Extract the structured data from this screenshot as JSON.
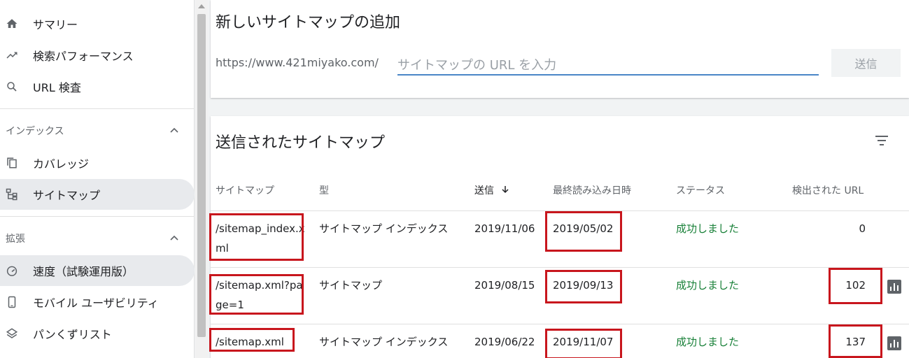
{
  "sidebar": {
    "items": [
      {
        "label": "サマリー",
        "icon": "home-icon"
      },
      {
        "label": "検索パフォーマンス",
        "icon": "trending-icon"
      },
      {
        "label": "URL 検査",
        "icon": "search-icon"
      }
    ],
    "index_section": {
      "title": "インデックス",
      "items": [
        {
          "label": "カバレッジ",
          "icon": "copy-icon"
        },
        {
          "label": "サイトマップ",
          "icon": "sitemap-icon",
          "selected": true
        }
      ]
    },
    "enhance_section": {
      "title": "拡張",
      "items": [
        {
          "label": "速度（試験運用版）",
          "icon": "speed-icon",
          "selected": true
        },
        {
          "label": "モバイル ユーザビリティ",
          "icon": "phone-icon"
        },
        {
          "label": "パンくずリスト",
          "icon": "layers-icon"
        }
      ]
    }
  },
  "add_sitemap": {
    "title": "新しいサイトマップの追加",
    "prefix": "https://www.421miyako.com/",
    "placeholder": "サイトマップの URL を入力",
    "submit_label": "送信"
  },
  "submitted": {
    "title": "送信されたサイトマップ",
    "columns": {
      "sitemap": "サイトマップ",
      "type": "型",
      "submitted": "送信",
      "last_read": "最終読み込み日時",
      "status": "ステータス",
      "urls": "検出された URL"
    },
    "rows": [
      {
        "sitemap": "/sitemap_index.xml",
        "type": "サイトマップ インデックス",
        "submitted": "2019/11/06",
        "last_read": "2019/05/02",
        "status": "成功しました",
        "urls": "0"
      },
      {
        "sitemap": "/sitemap.xml?page=1",
        "type": "サイトマップ",
        "submitted": "2019/08/15",
        "last_read": "2019/09/13",
        "status": "成功しました",
        "urls": "102"
      },
      {
        "sitemap": "/sitemap.xml",
        "type": "サイトマップ インデックス",
        "submitted": "2019/06/22",
        "last_read": "2019/11/07",
        "status": "成功しました",
        "urls": "137"
      }
    ]
  },
  "colors": {
    "highlight": "#c8161d",
    "success": "#188038",
    "input_underline": "#4a86c7"
  }
}
